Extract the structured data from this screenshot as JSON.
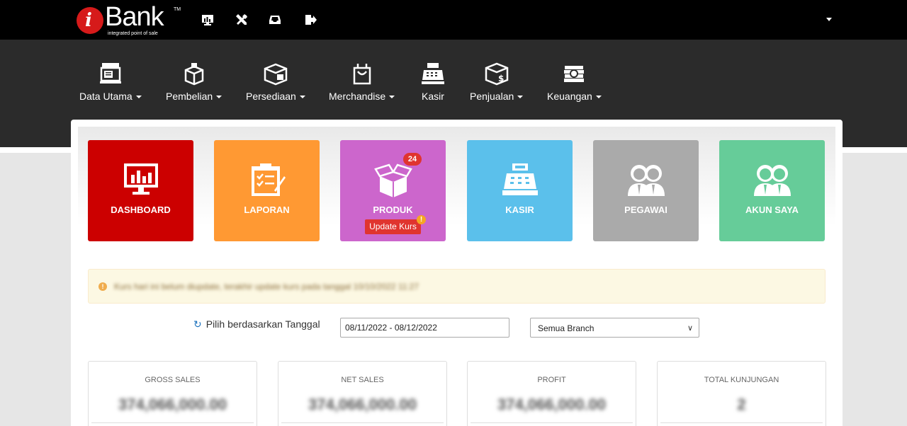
{
  "brand": {
    "name": "Bank",
    "tm": "TM",
    "tagline": "integrated point of sale"
  },
  "topbar_icons": [
    "monitor-chart-icon",
    "tools-icon",
    "inbox-icon",
    "sign-out-icon"
  ],
  "nav": [
    {
      "label": "Data Utama",
      "icon": "store-icon",
      "dropdown": true
    },
    {
      "label": "Pembelian",
      "icon": "open-box-icon",
      "dropdown": true
    },
    {
      "label": "Persediaan",
      "icon": "package-icon",
      "dropdown": true
    },
    {
      "label": "Merchandise",
      "icon": "shopping-bag-icon",
      "dropdown": true
    },
    {
      "label": "Kasir",
      "icon": "cash-register-icon",
      "dropdown": false
    },
    {
      "label": "Penjualan",
      "icon": "dollar-box-icon",
      "dropdown": true
    },
    {
      "label": "Keuangan",
      "icon": "money-stack-icon",
      "dropdown": true
    }
  ],
  "tiles": [
    {
      "label": "DASHBOARD",
      "color": "#cc0000",
      "icon": "monitor-chart-icon"
    },
    {
      "label": "LAPORAN",
      "color": "#ff9933",
      "icon": "clipboard-check-icon"
    },
    {
      "label": "PRODUK",
      "color": "#cc66cc",
      "icon": "open-box-icon",
      "badge": "24",
      "sub_button": "Update Kurs"
    },
    {
      "label": "KASIR",
      "color": "#5bc0eb",
      "icon": "cash-register-icon"
    },
    {
      "label": "PEGAWAI",
      "color": "#aaaaaa",
      "icon": "users-icon"
    },
    {
      "label": "AKUN SAYA",
      "color": "#66cc99",
      "icon": "users-icon"
    }
  ],
  "alert": {
    "text": "Kurs hari ini belum diupdate, terakhir update kurs pada tanggal 10/10/2022 11:27"
  },
  "filter": {
    "label": "Pilih berdasarkan Tanggal",
    "date_range": "08/11/2022 - 08/12/2022",
    "branch": "Semua Branch"
  },
  "stats": [
    {
      "label": "GROSS SALES",
      "value": "374,066,000.00"
    },
    {
      "label": "NET SALES",
      "value": "374,066,000.00"
    },
    {
      "label": "PROFIT",
      "value": "374,066,000.00"
    },
    {
      "label": "TOTAL KUNJUNGAN",
      "value": "2"
    }
  ]
}
